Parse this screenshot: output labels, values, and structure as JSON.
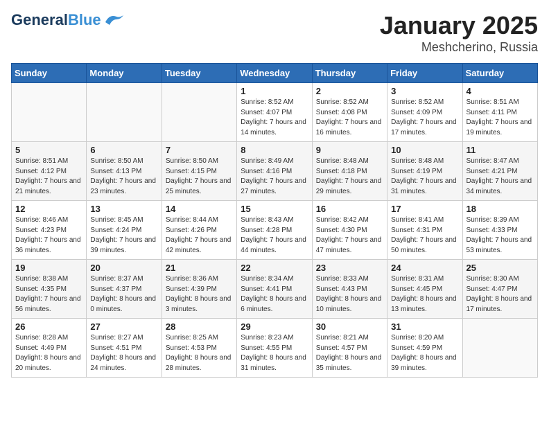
{
  "header": {
    "logo_general": "General",
    "logo_blue": "Blue",
    "month": "January 2025",
    "location": "Meshcherino, Russia"
  },
  "weekdays": [
    "Sunday",
    "Monday",
    "Tuesday",
    "Wednesday",
    "Thursday",
    "Friday",
    "Saturday"
  ],
  "weeks": [
    [
      {
        "day": null,
        "sunrise": null,
        "sunset": null,
        "daylight": null
      },
      {
        "day": null,
        "sunrise": null,
        "sunset": null,
        "daylight": null
      },
      {
        "day": null,
        "sunrise": null,
        "sunset": null,
        "daylight": null
      },
      {
        "day": "1",
        "sunrise": "8:52 AM",
        "sunset": "4:07 PM",
        "daylight": "7 hours and 14 minutes."
      },
      {
        "day": "2",
        "sunrise": "8:52 AM",
        "sunset": "4:08 PM",
        "daylight": "7 hours and 16 minutes."
      },
      {
        "day": "3",
        "sunrise": "8:52 AM",
        "sunset": "4:09 PM",
        "daylight": "7 hours and 17 minutes."
      },
      {
        "day": "4",
        "sunrise": "8:51 AM",
        "sunset": "4:11 PM",
        "daylight": "7 hours and 19 minutes."
      }
    ],
    [
      {
        "day": "5",
        "sunrise": "8:51 AM",
        "sunset": "4:12 PM",
        "daylight": "7 hours and 21 minutes."
      },
      {
        "day": "6",
        "sunrise": "8:50 AM",
        "sunset": "4:13 PM",
        "daylight": "7 hours and 23 minutes."
      },
      {
        "day": "7",
        "sunrise": "8:50 AM",
        "sunset": "4:15 PM",
        "daylight": "7 hours and 25 minutes."
      },
      {
        "day": "8",
        "sunrise": "8:49 AM",
        "sunset": "4:16 PM",
        "daylight": "7 hours and 27 minutes."
      },
      {
        "day": "9",
        "sunrise": "8:48 AM",
        "sunset": "4:18 PM",
        "daylight": "7 hours and 29 minutes."
      },
      {
        "day": "10",
        "sunrise": "8:48 AM",
        "sunset": "4:19 PM",
        "daylight": "7 hours and 31 minutes."
      },
      {
        "day": "11",
        "sunrise": "8:47 AM",
        "sunset": "4:21 PM",
        "daylight": "7 hours and 34 minutes."
      }
    ],
    [
      {
        "day": "12",
        "sunrise": "8:46 AM",
        "sunset": "4:23 PM",
        "daylight": "7 hours and 36 minutes."
      },
      {
        "day": "13",
        "sunrise": "8:45 AM",
        "sunset": "4:24 PM",
        "daylight": "7 hours and 39 minutes."
      },
      {
        "day": "14",
        "sunrise": "8:44 AM",
        "sunset": "4:26 PM",
        "daylight": "7 hours and 42 minutes."
      },
      {
        "day": "15",
        "sunrise": "8:43 AM",
        "sunset": "4:28 PM",
        "daylight": "7 hours and 44 minutes."
      },
      {
        "day": "16",
        "sunrise": "8:42 AM",
        "sunset": "4:30 PM",
        "daylight": "7 hours and 47 minutes."
      },
      {
        "day": "17",
        "sunrise": "8:41 AM",
        "sunset": "4:31 PM",
        "daylight": "7 hours and 50 minutes."
      },
      {
        "day": "18",
        "sunrise": "8:39 AM",
        "sunset": "4:33 PM",
        "daylight": "7 hours and 53 minutes."
      }
    ],
    [
      {
        "day": "19",
        "sunrise": "8:38 AM",
        "sunset": "4:35 PM",
        "daylight": "7 hours and 56 minutes."
      },
      {
        "day": "20",
        "sunrise": "8:37 AM",
        "sunset": "4:37 PM",
        "daylight": "8 hours and 0 minutes."
      },
      {
        "day": "21",
        "sunrise": "8:36 AM",
        "sunset": "4:39 PM",
        "daylight": "8 hours and 3 minutes."
      },
      {
        "day": "22",
        "sunrise": "8:34 AM",
        "sunset": "4:41 PM",
        "daylight": "8 hours and 6 minutes."
      },
      {
        "day": "23",
        "sunrise": "8:33 AM",
        "sunset": "4:43 PM",
        "daylight": "8 hours and 10 minutes."
      },
      {
        "day": "24",
        "sunrise": "8:31 AM",
        "sunset": "4:45 PM",
        "daylight": "8 hours and 13 minutes."
      },
      {
        "day": "25",
        "sunrise": "8:30 AM",
        "sunset": "4:47 PM",
        "daylight": "8 hours and 17 minutes."
      }
    ],
    [
      {
        "day": "26",
        "sunrise": "8:28 AM",
        "sunset": "4:49 PM",
        "daylight": "8 hours and 20 minutes."
      },
      {
        "day": "27",
        "sunrise": "8:27 AM",
        "sunset": "4:51 PM",
        "daylight": "8 hours and 24 minutes."
      },
      {
        "day": "28",
        "sunrise": "8:25 AM",
        "sunset": "4:53 PM",
        "daylight": "8 hours and 28 minutes."
      },
      {
        "day": "29",
        "sunrise": "8:23 AM",
        "sunset": "4:55 PM",
        "daylight": "8 hours and 31 minutes."
      },
      {
        "day": "30",
        "sunrise": "8:21 AM",
        "sunset": "4:57 PM",
        "daylight": "8 hours and 35 minutes."
      },
      {
        "day": "31",
        "sunrise": "8:20 AM",
        "sunset": "4:59 PM",
        "daylight": "8 hours and 39 minutes."
      },
      {
        "day": null,
        "sunrise": null,
        "sunset": null,
        "daylight": null
      }
    ]
  ]
}
